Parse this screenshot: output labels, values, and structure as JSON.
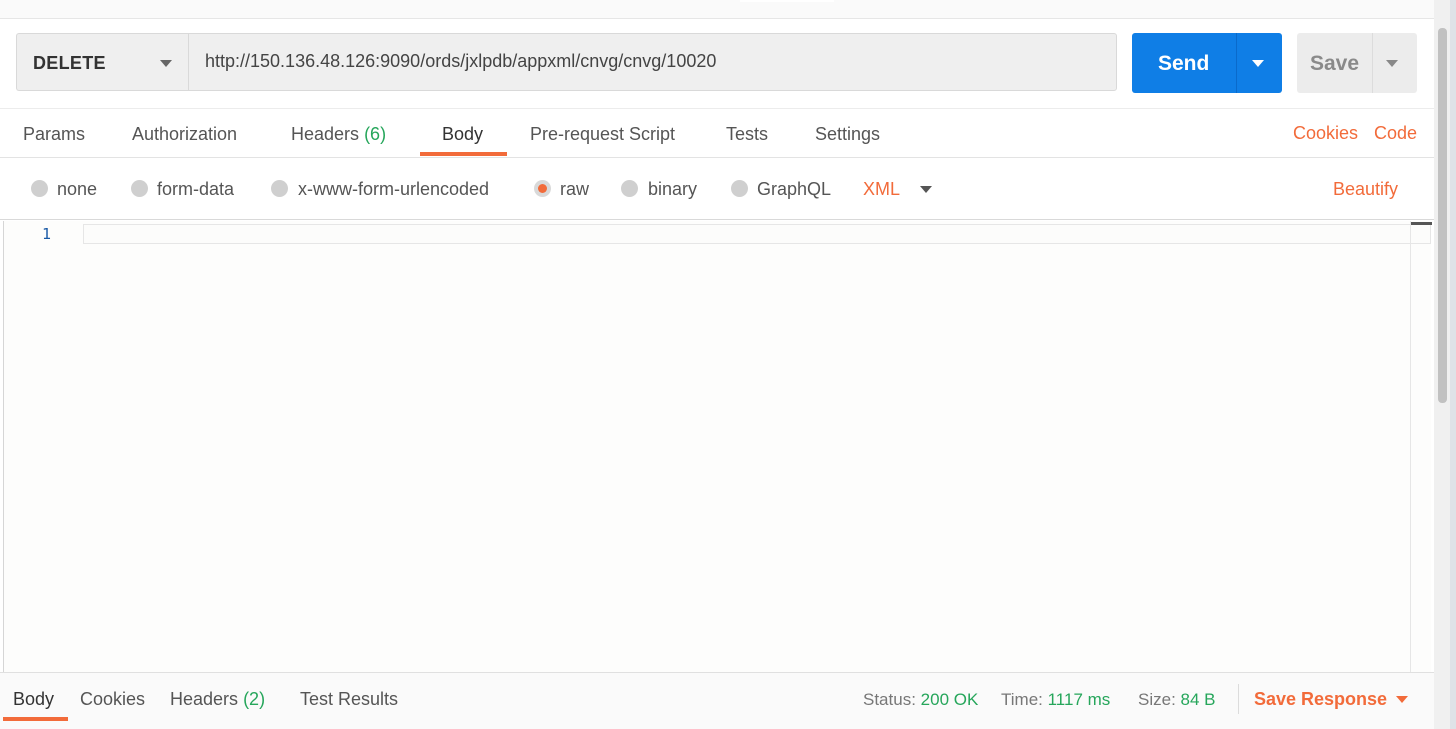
{
  "request": {
    "method": "DELETE",
    "url": "http://150.136.48.126:9090/ords/jxlpdb/appxml/cnvg/cnvg/10020",
    "send_label": "Send",
    "save_label": "Save"
  },
  "tabs": {
    "params": "Params",
    "authorization": "Authorization",
    "headers": "Headers",
    "headers_count": "(6)",
    "body": "Body",
    "prerequest": "Pre-request Script",
    "tests": "Tests",
    "settings": "Settings",
    "active": "Body"
  },
  "links": {
    "cookies": "Cookies",
    "code": "Code"
  },
  "body_options": {
    "none": "none",
    "form_data": "form-data",
    "urlencoded": "x-www-form-urlencoded",
    "raw": "raw",
    "binary": "binary",
    "graphql": "GraphQL",
    "selected": "raw",
    "format": "XML",
    "beautify": "Beautify"
  },
  "editor": {
    "line_numbers": [
      "1"
    ],
    "content": ""
  },
  "response": {
    "tabs": {
      "body": "Body",
      "cookies": "Cookies",
      "headers": "Headers",
      "headers_count": "(2)",
      "test_results": "Test Results",
      "active": "Body"
    },
    "status_label": "Status:",
    "status_value": "200 OK",
    "time_label": "Time:",
    "time_value": "1117 ms",
    "size_label": "Size:",
    "size_value": "84 B",
    "save_response": "Save Response"
  },
  "colors": {
    "accent": "#f26b3a",
    "send_button": "#0f7ee6",
    "success": "#26a65b"
  }
}
